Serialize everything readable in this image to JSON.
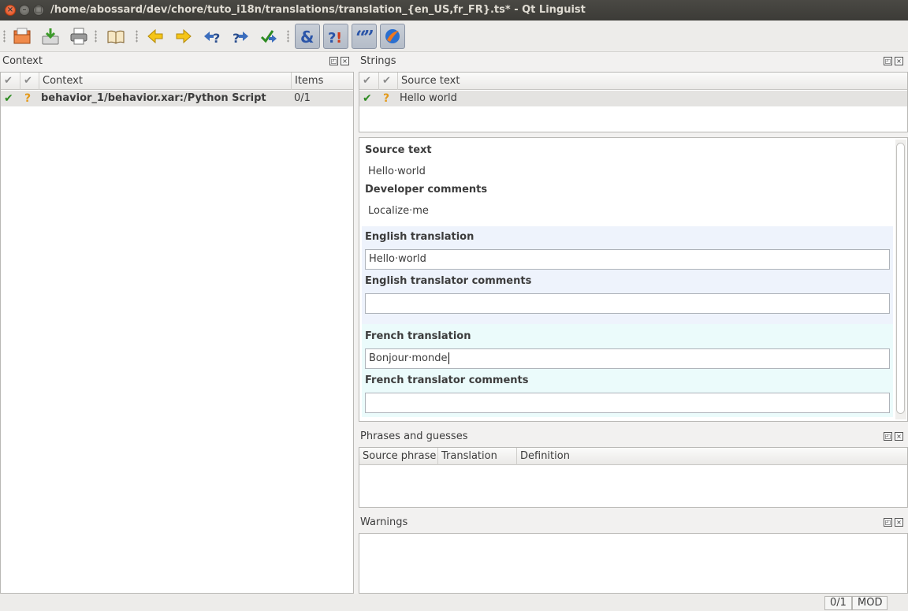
{
  "window": {
    "title": "/home/abossard/dev/chore/tuto_i18n/translations/translation_{en_US,fr_FR}.ts* - Qt Linguist"
  },
  "toolbar": {
    "buttons": [
      {
        "name": "open-icon"
      },
      {
        "name": "save-icon"
      },
      {
        "name": "print-icon"
      },
      {
        "name": "phrasebook-icon"
      },
      {
        "name": "prev-icon"
      },
      {
        "name": "next-icon"
      },
      {
        "name": "prev-unfinished-icon"
      },
      {
        "name": "next-unfinished-icon"
      },
      {
        "name": "done-next-icon"
      },
      {
        "name": "accelerators-validation-icon"
      },
      {
        "name": "punctuation-validation-icon"
      },
      {
        "name": "phrase-validation-icon"
      },
      {
        "name": "placemarker-validation-icon"
      }
    ]
  },
  "context_panel": {
    "title": "Context",
    "columns": [
      "Context",
      "Items"
    ],
    "rows": [
      {
        "context": "behavior_1/behavior.xar:/Python Script",
        "items": "0/1"
      }
    ]
  },
  "strings_panel": {
    "title": "Strings",
    "columns": [
      "Source text"
    ],
    "rows": [
      {
        "source": "Hello world"
      }
    ]
  },
  "editor": {
    "source_text_label": "Source text",
    "source_text": "Hello·world",
    "dev_comments_label": "Developer comments",
    "dev_comments": "Localize·me",
    "english_translation_label": "English translation",
    "english_translation": "Hello·world",
    "english_comments_label": "English translator comments",
    "english_comments": "",
    "french_translation_label": "French translation",
    "french_translation": "Bonjour·monde",
    "french_comments_label": "French translator comments",
    "french_comments": ""
  },
  "phrases_panel": {
    "title": "Phrases and guesses",
    "columns": [
      "Source phrase",
      "Translation",
      "Definition"
    ]
  },
  "warnings_panel": {
    "title": "Warnings"
  },
  "statusbar": {
    "progress": "0/1",
    "mode": "MOD"
  },
  "colors": {
    "english_section": "#eef3fc",
    "french_section": "#ebfbfb",
    "done_check": "#2e8b22",
    "unfinished": "#e39a1b"
  }
}
